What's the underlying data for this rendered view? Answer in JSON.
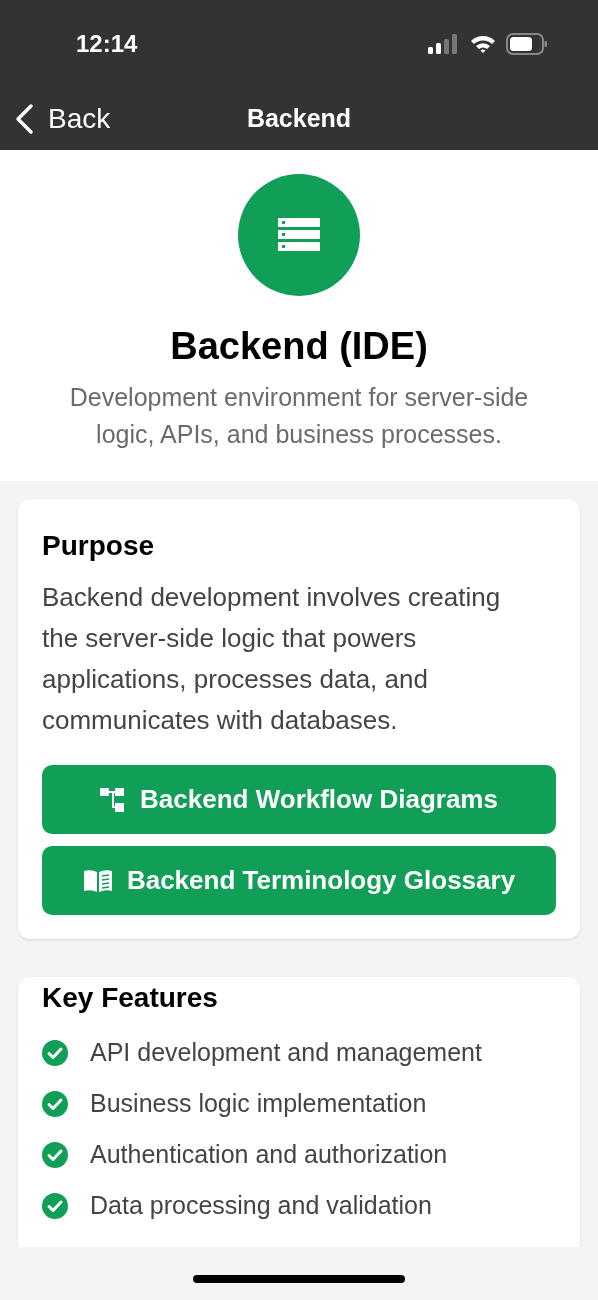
{
  "status_bar": {
    "time": "12:14"
  },
  "nav": {
    "back": "Back",
    "title": "Backend"
  },
  "header": {
    "title": "Backend (IDE)",
    "subtitle": "Development environment for server-side logic, APIs, and business processes."
  },
  "purpose": {
    "title": "Purpose",
    "text": "Backend development involves creating the server-side logic that powers applications, processes data, and communicates with databases.",
    "buttons": [
      {
        "label": "Backend Workflow Diagrams",
        "kind": "diagram"
      },
      {
        "label": "Backend Terminology Glossary",
        "kind": "glossary"
      }
    ]
  },
  "features": {
    "title": "Key Features",
    "items": [
      "API development and management",
      "Business logic implementation",
      "Authentication and authorization",
      "Data processing and validation"
    ]
  }
}
